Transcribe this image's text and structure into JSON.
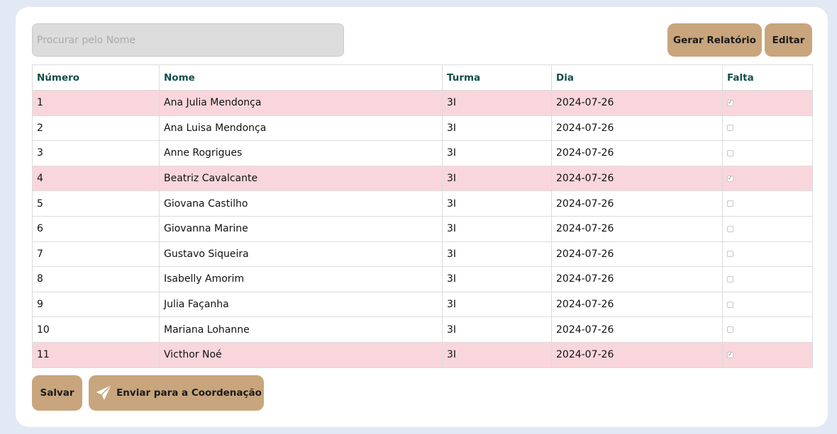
{
  "search": {
    "placeholder": "Procurar pelo Nome"
  },
  "toolbar": {
    "report_label": "Gerar Relatório",
    "edit_label": "Editar"
  },
  "table": {
    "headers": [
      "Número",
      "Nome",
      "Turma",
      "Dia",
      "Falta"
    ],
    "rows": [
      {
        "numero": "1",
        "nome": "Ana Julia Mendonça",
        "turma": "3I",
        "dia": "2024-07-26",
        "falta": true
      },
      {
        "numero": "2",
        "nome": "Ana Luisa Mendonça",
        "turma": "3I",
        "dia": "2024-07-26",
        "falta": false
      },
      {
        "numero": "3",
        "nome": "Anne Rogrigues",
        "turma": "3I",
        "dia": "2024-07-26",
        "falta": false
      },
      {
        "numero": "4",
        "nome": "Beatriz Cavalcante",
        "turma": "3I",
        "dia": "2024-07-26",
        "falta": true
      },
      {
        "numero": "5",
        "nome": "Giovana Castilho",
        "turma": "3I",
        "dia": "2024-07-26",
        "falta": false
      },
      {
        "numero": "6",
        "nome": "Giovanna Marine",
        "turma": "3I",
        "dia": "2024-07-26",
        "falta": false
      },
      {
        "numero": "7",
        "nome": "Gustavo Siqueira",
        "turma": "3I",
        "dia": "2024-07-26",
        "falta": false
      },
      {
        "numero": "8",
        "nome": "Isabelly Amorim",
        "turma": "3I",
        "dia": "2024-07-26",
        "falta": false
      },
      {
        "numero": "9",
        "nome": "Julia Façanha",
        "turma": "3I",
        "dia": "2024-07-26",
        "falta": false
      },
      {
        "numero": "10",
        "nome": "Mariana Lohanne",
        "turma": "3I",
        "dia": "2024-07-26",
        "falta": false
      },
      {
        "numero": "11",
        "nome": "Victhor Noé",
        "turma": "3I",
        "dia": "2024-07-26",
        "falta": true
      }
    ]
  },
  "footer": {
    "save_label": "Salvar",
    "send_label": "Enviar para a Coordenação",
    "send_icon": "paper-plane-icon"
  },
  "colors": {
    "accent": "#c8a57c",
    "absent_row": "#f9d6dc",
    "header_text": "#134e4a",
    "background": "#e3e8f5"
  }
}
